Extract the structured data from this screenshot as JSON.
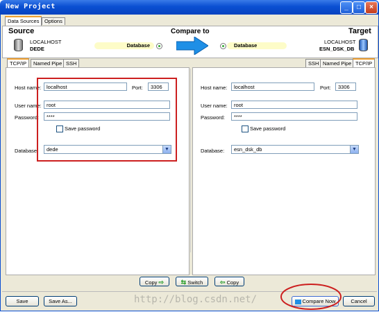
{
  "window": {
    "title": "New Project"
  },
  "top_tabs": [
    "Data Sources",
    "Options"
  ],
  "header": {
    "source_label": "Source",
    "source_server": "LOCALHOST",
    "source_db": "DEDE",
    "compare_label": "Compare to",
    "target_label": "Target",
    "target_server": "LOCALHOST",
    "target_db": "ESN_DSK_DB",
    "left_pill": "Database",
    "right_pill": "Database"
  },
  "source_tabs": [
    "TCP/IP",
    "Named Pipe",
    "SSH"
  ],
  "target_tabs": [
    "SSH",
    "Named Pipe",
    "TCP/IP"
  ],
  "source_form": {
    "host_label": "Host name:",
    "host_value": "localhost",
    "port_label": "Port:",
    "port_value": "3306",
    "user_label": "User name:",
    "user_value": "root",
    "pass_label": "Password:",
    "pass_value": "****",
    "save_pw_label": "Save password",
    "db_label": "Database:",
    "db_value": "dede"
  },
  "target_form": {
    "host_label": "Host name:",
    "host_value": "localhost",
    "port_label": "Port:",
    "port_value": "3306",
    "user_label": "User name:",
    "user_value": "root",
    "pass_label": "Password:",
    "pass_value": "****",
    "save_pw_label": "Save password",
    "db_label": "Database:",
    "db_value": "esn_dsk_db"
  },
  "middle_buttons": {
    "copy_right": "Copy",
    "switch": "Switch",
    "copy_left": "Copy"
  },
  "bottom_buttons": {
    "save": "Save",
    "save_as": "Save As...",
    "compare_now": "Compare Now",
    "cancel": "Cancel"
  },
  "watermark": "http://blog.csdn.net/",
  "colors": {
    "title_bar": "#0a4fd2",
    "window_bg": "#ece9d8",
    "highlight_box": "#cc1f1f",
    "arrow": "#1e8fe6",
    "pill": "#fdfcc8"
  }
}
